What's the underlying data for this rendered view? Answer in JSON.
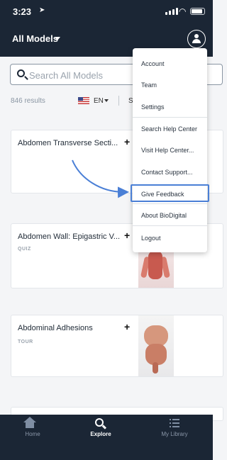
{
  "status_bar": {
    "time": "3:23",
    "location_arrow": "location-arrow-icon"
  },
  "header": {
    "title": "All Models"
  },
  "search": {
    "placeholder": "Search All Models"
  },
  "results": {
    "count_text": "846 results",
    "language": "EN",
    "sort_fragment": "S"
  },
  "cards": [
    {
      "title": "Abdomen Transverse Secti...",
      "type": ""
    },
    {
      "title": "Abdomen Wall: Epigastric V...",
      "type": "QUIZ"
    },
    {
      "title": "Abdominal Adhesions",
      "type": "TOUR"
    }
  ],
  "menu": {
    "items": [
      "Account",
      "Team",
      "Settings",
      "Search Help Center",
      "Visit Help Center...",
      "Contact Support...",
      "Give Feedback",
      "About BioDigital",
      "Logout"
    ],
    "highlighted": "Give Feedback"
  },
  "tabbar": {
    "items": [
      {
        "label": "Home",
        "icon": "home-icon"
      },
      {
        "label": "Explore",
        "icon": "search-icon"
      },
      {
        "label": "My Library",
        "icon": "list-icon"
      }
    ],
    "active": "Explore"
  },
  "colors": {
    "header_bg": "#1b2635",
    "accent": "#4a7fd6"
  }
}
